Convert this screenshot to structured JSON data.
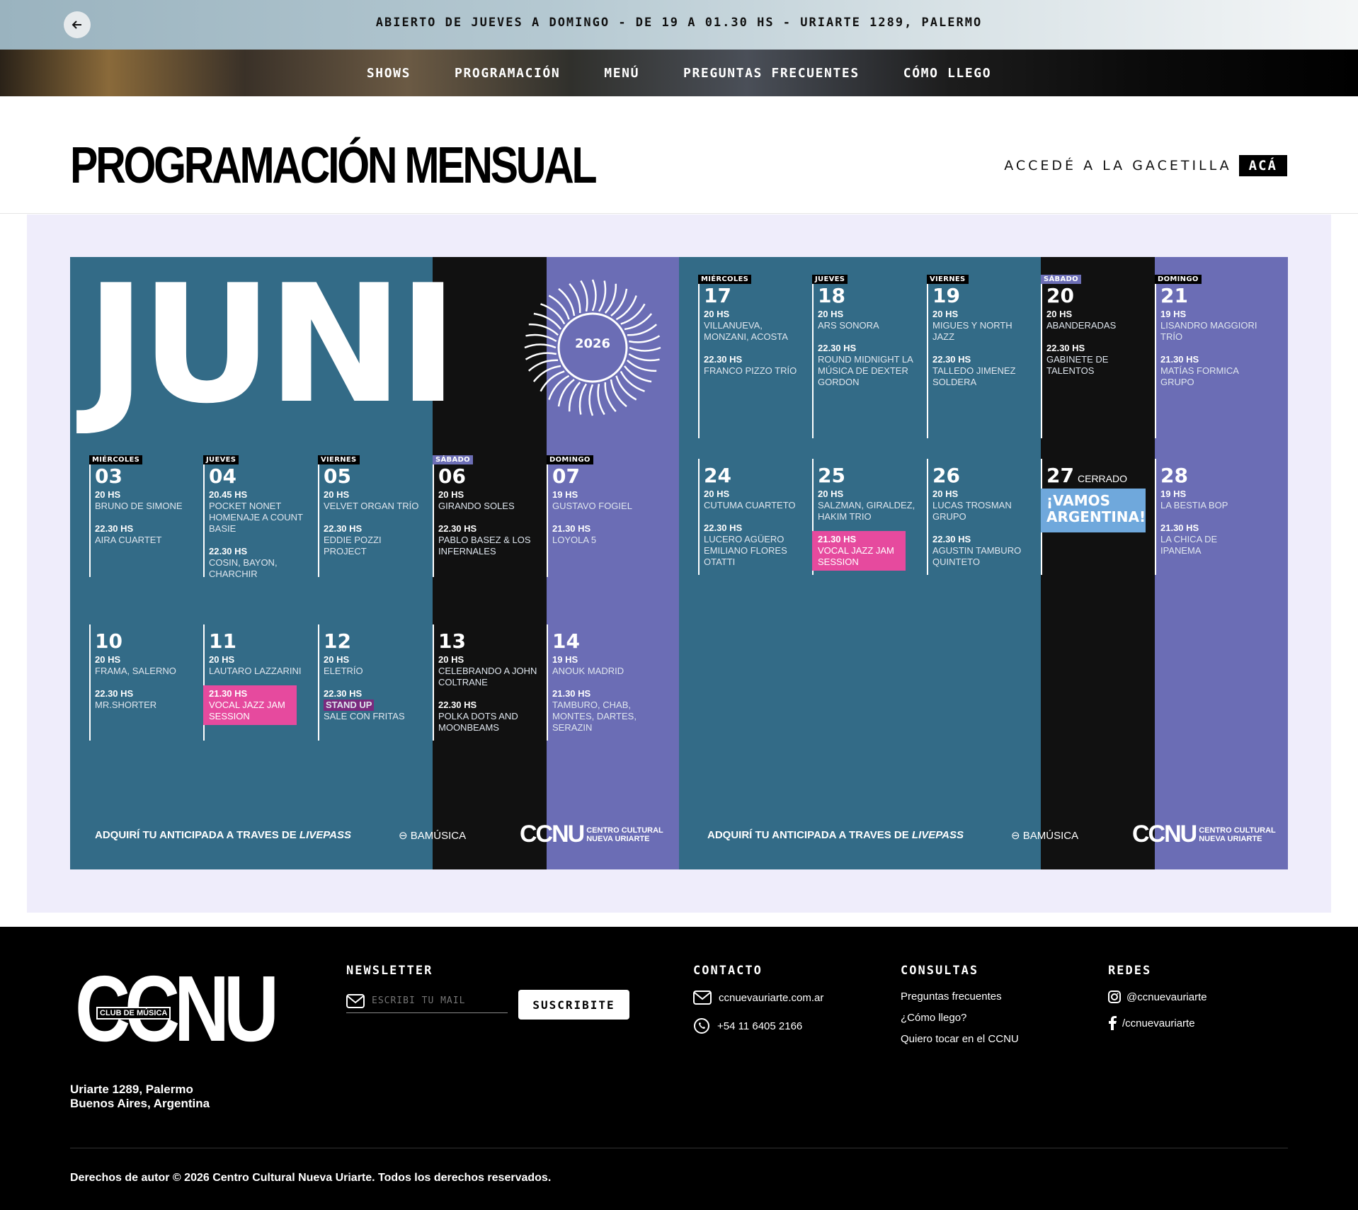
{
  "topbar": {
    "message": "ABIERTO DE JUEVES A DOMINGO - DE 19 A 01.30 HS - URIARTE 1289, PALERMO",
    "back_icon": "arrow-left-icon"
  },
  "nav": {
    "items": [
      "SHOWS",
      "PROGRAMACIÓN",
      "MENÚ",
      "PREGUNTAS FRECUENTES",
      "CÓMO LLEGO"
    ]
  },
  "header": {
    "title": "PROGRAMACIÓN MENSUAL",
    "gacetilla_text": "ACCEDÉ A LA GACETILLA",
    "gacetilla_link": "ACÁ"
  },
  "poster": {
    "month": "JUNI",
    "year": "2026",
    "colors": {
      "blue": "#336b87",
      "black": "#111111",
      "purple": "#6b6db5",
      "pink": "#e64a9e",
      "light_blue": "#6fa8dc"
    },
    "weekdays": [
      "MIÉRCOLES",
      "JUEVES",
      "VIERNES",
      "SÁBADO",
      "DOMINGO"
    ],
    "weeks_left": [
      [
        {
          "day": "03",
          "events": [
            {
              "time": "20 HS",
              "name": "BRUNO DE SIMONE"
            },
            {
              "time": "22.30 HS",
              "name": "AIRA CUARTET"
            }
          ]
        },
        {
          "day": "04",
          "events": [
            {
              "time": "20.45 HS",
              "name": "POCKET NONET HOMENAJE A COUNT BASIE"
            },
            {
              "time": "22.30 HS",
              "name": "COSIN, BAYON, CHARCHIR"
            }
          ]
        },
        {
          "day": "05",
          "events": [
            {
              "time": "20 HS",
              "name": "VELVET ORGAN TRÍO"
            },
            {
              "time": "22.30 HS",
              "name": "EDDIE POZZI PROJECT"
            }
          ]
        },
        {
          "day": "06",
          "events": [
            {
              "time": "20 HS",
              "name": "GIRANDO SOLES"
            },
            {
              "time": "22.30 HS",
              "name": "PABLO BASEZ & LOS INFERNALES"
            }
          ]
        },
        {
          "day": "07",
          "events": [
            {
              "time": "19 HS",
              "name": "GUSTAVO FOGIEL"
            },
            {
              "time": "21.30 HS",
              "name": "LOYOLA 5"
            }
          ]
        }
      ],
      [
        {
          "day": "10",
          "events": [
            {
              "time": "20 HS",
              "name": "FRAMA, SALERNO"
            },
            {
              "time": "22.30 HS",
              "name": "MR.SHORTER"
            }
          ]
        },
        {
          "day": "11",
          "events": [
            {
              "time": "20 HS",
              "name": "LAUTARO LAZZARINI"
            },
            {
              "time": "21.30 HS",
              "name": "VOCAL JAZZ JAM SESSION",
              "highlight": true
            }
          ]
        },
        {
          "day": "12",
          "events": [
            {
              "time": "20 HS",
              "name": "ELETRÍO"
            },
            {
              "time": "22.30 HS",
              "tag": "STAND UP",
              "name": "SALE CON FRITAS"
            }
          ]
        },
        {
          "day": "13",
          "events": [
            {
              "time": "20 HS",
              "name": "CELEBRANDO A JOHN COLTRANE"
            },
            {
              "time": "22.30 HS",
              "name": "POLKA DOTS AND MOONBEAMS"
            }
          ]
        },
        {
          "day": "14",
          "events": [
            {
              "time": "19 HS",
              "name": "ANOUK MADRID"
            },
            {
              "time": "21.30 HS",
              "name": "TAMBURO, CHAB, MONTES, DARTES, SERAZIN"
            }
          ]
        }
      ]
    ],
    "weeks_right": [
      [
        {
          "day": "17",
          "events": [
            {
              "time": "20 HS",
              "name": "VILLANUEVA, MONZANI, ACOSTA"
            },
            {
              "time": "22.30 HS",
              "name": "FRANCO PIZZO TRÍO"
            }
          ]
        },
        {
          "day": "18",
          "events": [
            {
              "time": "20 HS",
              "name": "ARS SONORA"
            },
            {
              "time": "22.30 HS",
              "name": "ROUND MIDNIGHT LA MÚSICA DE DEXTER GORDON"
            }
          ]
        },
        {
          "day": "19",
          "events": [
            {
              "time": "20 HS",
              "name": "MIGUES Y NORTH JAZZ"
            },
            {
              "time": "22.30 HS",
              "name": "TALLEDO JIMENEZ SOLDERA"
            }
          ]
        },
        {
          "day": "20",
          "events": [
            {
              "time": "20 HS",
              "name": "ABANDERADAS"
            },
            {
              "time": "22.30 HS",
              "name": "GABINETE DE TALENTOS"
            }
          ]
        },
        {
          "day": "21",
          "events": [
            {
              "time": "19 HS",
              "name": "LISANDRO MAGGIORI TRÍO"
            },
            {
              "time": "21.30 HS",
              "name": "MATÍAS FORMICA GRUPO"
            }
          ]
        }
      ],
      [
        {
          "day": "24",
          "events": [
            {
              "time": "20 HS",
              "name": "CUTUMA CUARTETO"
            },
            {
              "time": "22.30 HS",
              "name": "LUCERO AGÜERO EMILIANO FLORES OTATTI"
            }
          ]
        },
        {
          "day": "25",
          "events": [
            {
              "time": "20 HS",
              "name": "SALZMAN, GIRALDEZ, HAKIM TRIO"
            },
            {
              "time": "21.30 HS",
              "name": "VOCAL JAZZ JAM SESSION",
              "highlight": true
            }
          ]
        },
        {
          "day": "26",
          "events": [
            {
              "time": "20 HS",
              "name": "LUCAS TROSMAN GRUPO"
            },
            {
              "time": "22.30 HS",
              "name": "AGUSTIN TAMBURO QUINTETO"
            }
          ]
        },
        {
          "day": "27",
          "closed": "CERRADO",
          "banner": "¡VAMOS ARGENTINA!",
          "events": []
        },
        {
          "day": "28",
          "events": [
            {
              "time": "19 HS",
              "name": "LA BESTIA BOP"
            },
            {
              "time": "21.30 HS",
              "name": "LA CHICA DE IPANEMA"
            }
          ]
        }
      ]
    ],
    "footer": {
      "ticket_text": "ADQUIRÍ TU ANTICIPADA A TRAVES DE",
      "ticket_brand": "LIVEPASS",
      "sponsor": "BAMÚSICA",
      "logo": "CCNU",
      "logo_sub1": "CENTRO CULTURAL",
      "logo_sub2": "NUEVA URIARTE"
    }
  },
  "footer": {
    "logo": "CCNU",
    "logo_tag": "CLUB DE MÚSICA",
    "address_line1": "Uriarte 1289, Palermo",
    "address_line2": "Buenos Aires, Argentina",
    "newsletter": {
      "heading": "NEWSLETTER",
      "placeholder": "ESCRIBÍ TU MAIL",
      "button": "SUSCRIBITE"
    },
    "contact": {
      "heading": "CONTACTO",
      "email": "ccnuevauriarte.com.ar",
      "phone": "+54 11 6405 2166"
    },
    "consultas": {
      "heading": "CONSULTAS",
      "links": [
        "Preguntas frecuentes",
        "¿Cómo llego?",
        "Quiero tocar en el CCNU"
      ]
    },
    "redes": {
      "heading": "REDES",
      "instagram": "@ccnuevauriarte",
      "facebook": "/ccnuevauriarte"
    },
    "copyright": "Derechos de autor © 2026 Centro Cultural Nueva Uriarte. Todos los derechos reservados."
  }
}
